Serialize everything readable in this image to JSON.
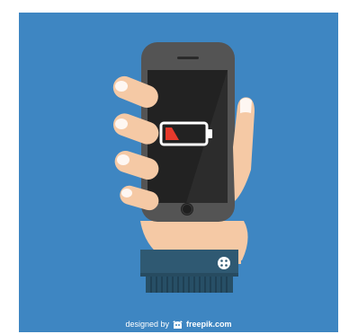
{
  "illustration": {
    "subject": "hand holding smartphone with low battery",
    "battery_level": 0.2,
    "colors": {
      "background": "#3e86c2",
      "phone_body": "#545454",
      "screen": "#222222",
      "skin": "#f5c9a5",
      "sleeve": "#2f5972",
      "battery_outline": "#ffffff",
      "battery_fill": "#e63a2c"
    }
  },
  "credit": {
    "prefix": "designed by",
    "brand": "freepik.com",
    "logo_icon": "freepik-logo-icon"
  }
}
